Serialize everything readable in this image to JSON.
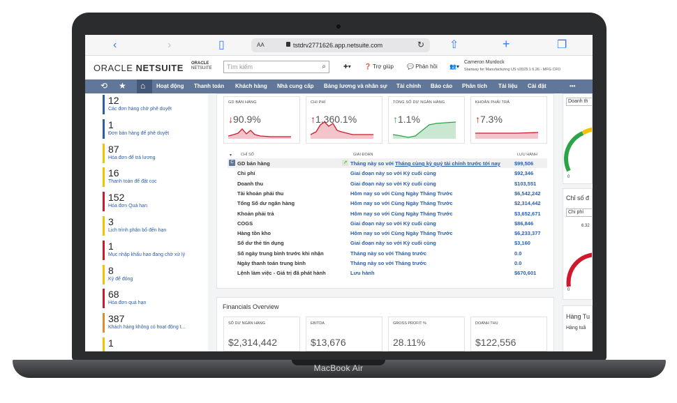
{
  "device": {
    "label": "MacBook Air"
  },
  "browser": {
    "text_size_label": "AA",
    "url": "tstdrv2771626.app.netsuite.com"
  },
  "header": {
    "logo_oracle": "ORACLE",
    "logo_netsuite": "NETSUITE",
    "logo_small_top": "ORACLE",
    "logo_small_bottom": "NETSUITE",
    "search_placeholder": "Tìm kiếm",
    "help": "Trợ giúp",
    "feedback": "Phản hồi",
    "user_name": "Cameron Murdock",
    "user_role": "Stairway for Manufacturing US v2023.1 6.26 - MFG CFO"
  },
  "nav": {
    "items": [
      "Hoạt động",
      "Thanh toán",
      "Khách hàng",
      "Nhà cung cấp",
      "Bảng lương và nhân sự",
      "Tài chính",
      "Báo cáo",
      "Phân tích",
      "Tài liệu",
      "Cài đặt"
    ],
    "more": "•••"
  },
  "reminders": [
    {
      "count": "12",
      "label": "Các đơn hàng chờ phê duyệt",
      "color": "#2a5da8"
    },
    {
      "count": "1",
      "label": "Đơn bán hàng để phê duyệt",
      "color": "#2a5da8"
    },
    {
      "count": "87",
      "label": "Hóa đơn để trả lương",
      "color": "#f2c300"
    },
    {
      "count": "16",
      "label": "Thanh toán để đặt cọc",
      "color": "#f2c300"
    },
    {
      "count": "152",
      "label": "Hóa đơn Quá hạn",
      "color": "#d0182b"
    },
    {
      "count": "3",
      "label": "Lịch trình phân bổ đến hạn",
      "color": "#f2c300"
    },
    {
      "count": "1",
      "label": "Mục nhập khấu hao đang chờ xử lý",
      "color": "#d0182b"
    },
    {
      "count": "8",
      "label": "Kỳ để đóng",
      "color": "#f2c300"
    },
    {
      "count": "68",
      "label": "Hóa đơn quá hạn",
      "color": "#d0182b"
    },
    {
      "count": "387",
      "label": "Khách hàng không có hoạt động t...",
      "color": "#e08a2a"
    },
    {
      "count": "1",
      "label": "",
      "color": "#f2c300"
    }
  ],
  "kpis": [
    {
      "title": "GD BÁN HÀNG",
      "value": "90.9%",
      "arrow": "↓",
      "trend": "red"
    },
    {
      "title": "CHI PHÍ",
      "value": "1,360.1%",
      "arrow": "↑",
      "trend": "red"
    },
    {
      "title": "TỔNG SỐ DƯ NGÂN HÀNG",
      "value": "1.1%",
      "arrow": "↑",
      "trend": "green"
    },
    {
      "title": "KHOẢN PHẢI TRẢ",
      "value": "7.3%",
      "arrow": "↑",
      "trend": "red"
    }
  ],
  "table": {
    "headers": [
      "CHỈ SỐ",
      "GIAI ĐOẠN",
      "LƯU HÀNH"
    ],
    "rows": [
      {
        "metric": "GD bán hàng",
        "period_prefix": "Tháng này so với ",
        "period_link": "Tháng cùng kỳ quý tài chính trước tới nay",
        "value": "$99,506"
      },
      {
        "metric": "Chi phí",
        "period_prefix": "Giai đoạn này so với ",
        "period_link": "Kỳ cuối cùng",
        "value": "$92,346"
      },
      {
        "metric": "Doanh thu",
        "period_prefix": "Giai đoạn này so với ",
        "period_link": "Kỳ cuối cùng",
        "value": "$103,551"
      },
      {
        "metric": "Tài khoản phải thu",
        "period_prefix": "Hôm nay so với ",
        "period_link": "Cùng Ngày Tháng Trước",
        "value": "$6,542,242"
      },
      {
        "metric": "Tổng Số dư ngân hàng",
        "period_prefix": "Hôm nay so với ",
        "period_link": "Cùng Ngày Tháng Trước",
        "value": "$2,314,442"
      },
      {
        "metric": "Khoản phải trả",
        "period_prefix": "Hôm nay so với ",
        "period_link": "Cùng Ngày Tháng Trước",
        "value": "$3,652,671"
      },
      {
        "metric": "COGS",
        "period_prefix": "Giai đoạn này so với ",
        "period_link": "Kỳ cuối cùng",
        "value": "$86,846"
      },
      {
        "metric": "Hàng tồn kho",
        "period_prefix": "Hôm nay so với ",
        "period_link": "Cùng Ngày Tháng Trước",
        "value": "$6,233,377"
      },
      {
        "metric": "Số dư thẻ tín dụng",
        "period_prefix": "Giai đoạn này so với ",
        "period_link": "Kỳ cuối cùng",
        "value": "$3,160"
      },
      {
        "metric": "Số ngày trung bình trước khi nhận",
        "period_prefix": "Tháng này so với ",
        "period_link": "Tháng trước",
        "value": "0.0"
      },
      {
        "metric": "Ngày thanh toán trung bình",
        "period_prefix": "Tháng này so với ",
        "period_link": "Tháng trước",
        "value": "0.0"
      },
      {
        "metric": "Lệnh làm việc - Giá trị đã phát hành",
        "period_prefix": "Lưu hành",
        "period_link": "",
        "value": "$670,601"
      }
    ]
  },
  "financials": {
    "title": "Financials Overview",
    "kpis": [
      {
        "title": "SỐ DƯ NGÂN HÀNG",
        "value": "$2,314,442"
      },
      {
        "title": "EBITDA",
        "value": "$13,676"
      },
      {
        "title": "GROSS PROFIT %",
        "value": "28.11%"
      },
      {
        "title": "DOANH THU",
        "value": "$122,556"
      }
    ]
  },
  "right": {
    "select1": "Doanh th",
    "gauge1_min": "0",
    "title2": "Chỉ số đ",
    "select2": "Chi phí",
    "gauge2_label": "6.32",
    "gauge2_min": "0",
    "title3": "Hàng Tu",
    "select3": "Hàng tuầ"
  },
  "colors": {
    "nav": "#607799",
    "link": "#2a5da8",
    "red": "#d0182b",
    "green": "#2aa446"
  }
}
